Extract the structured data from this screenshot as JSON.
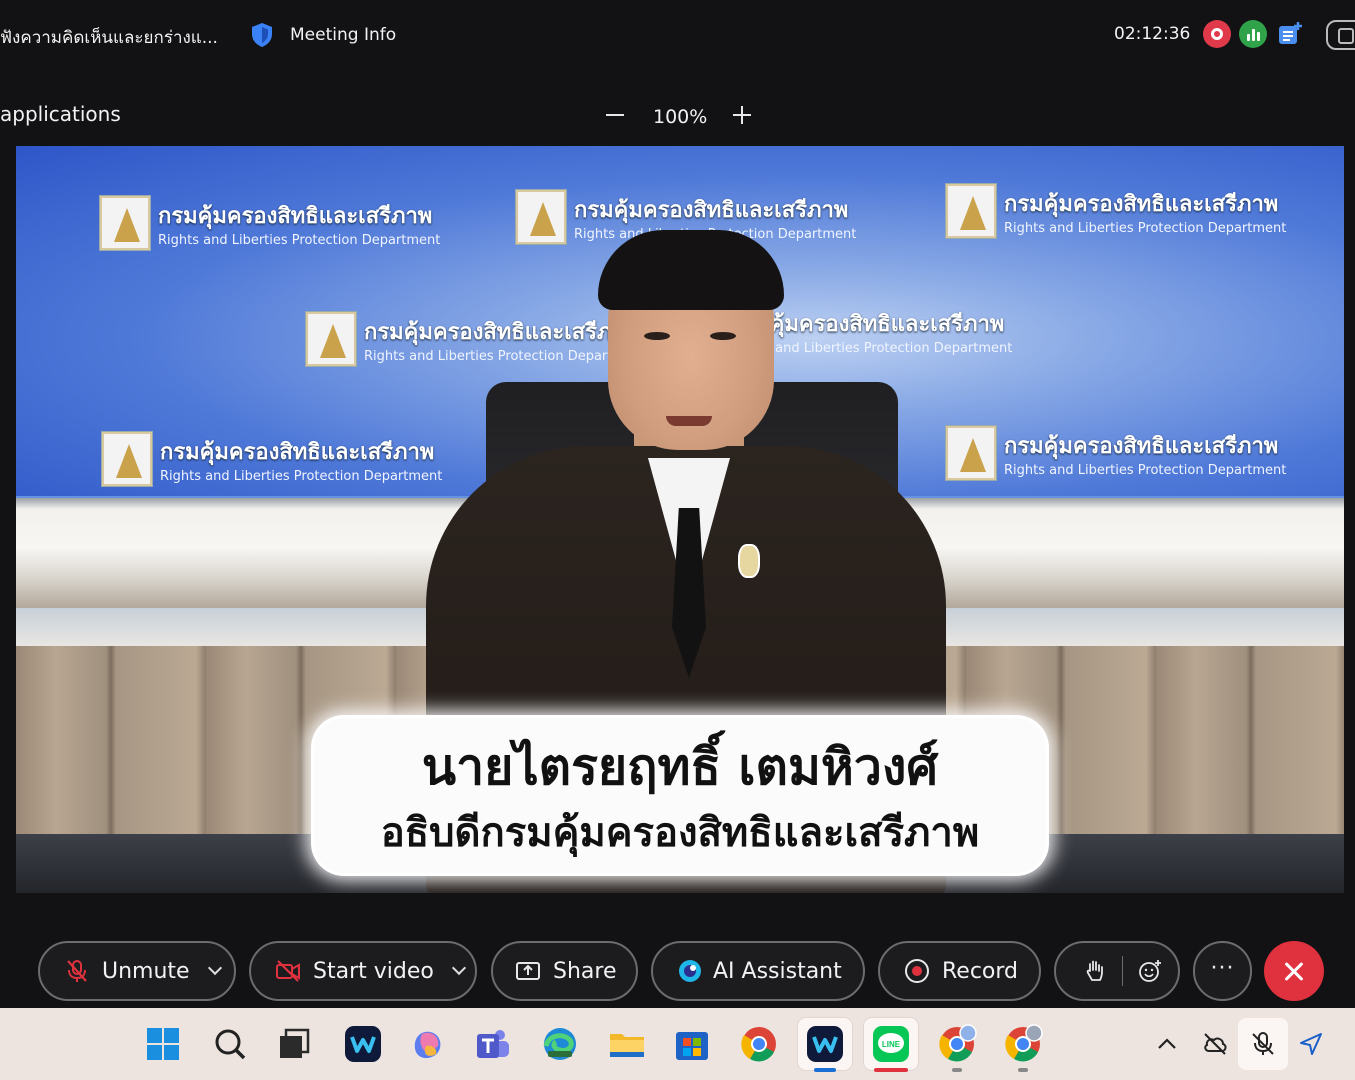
{
  "title_bar": {
    "meeting_title": "ฟังความคิดเห็นและยกร่างแ...",
    "meeting_info": "Meeting Info",
    "timer": "02:12:36",
    "icons": [
      "shield-icon",
      "recording-indicator-icon",
      "stats-icon",
      "notes-icon",
      "layout-icon"
    ]
  },
  "share_bar": {
    "label": "applications",
    "zoom": "100%"
  },
  "video": {
    "backdrop_org_th": "กรมคุ้มครองสิทธิและเสรีภาพ",
    "backdrop_org_en": "Rights and Liberties Protection Department",
    "caption_name": "นายไตรยฤทธิ์  เตมหิวงศ์",
    "caption_title": "อธิบดีกรมคุ้มครองสิทธิและเสรีภาพ"
  },
  "controls": {
    "unmute": "Unmute",
    "start_video": "Start video",
    "share": "Share",
    "ai_assistant": "AI Assistant",
    "record": "Record"
  },
  "taskbar": {
    "apps": [
      "windows-start",
      "search",
      "task-view",
      "webex",
      "copilot",
      "teams",
      "edge",
      "file-explorer",
      "microsoft-store",
      "chrome",
      "webex-active",
      "line",
      "chrome-profile-1",
      "chrome-profile-2"
    ],
    "tray": [
      "chevron-up-icon",
      "cloud-off-icon",
      "mic-muted-icon",
      "location-icon"
    ]
  },
  "colors": {
    "end_call": "#e0323e",
    "record_red": "#e03a4a",
    "stats_green": "#2fa24a",
    "backdrop_blue": "#2e56c8"
  }
}
